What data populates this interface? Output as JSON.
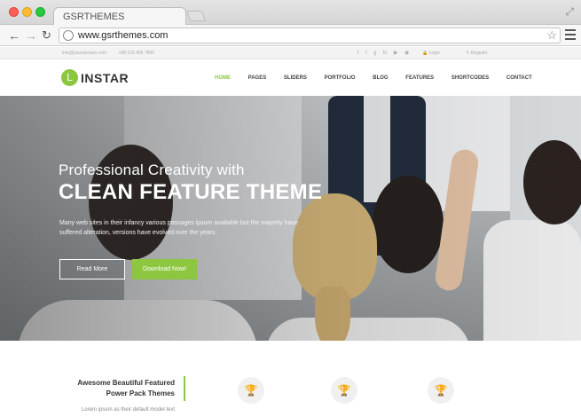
{
  "browser": {
    "tab_title": "GSRTHEMES",
    "url": "www.gsrthemes.com"
  },
  "infobar": {
    "email": "info@yourdomain.com",
    "phone": "+88 123 456 7890",
    "social_icons": [
      "twitter-icon",
      "facebook-icon",
      "google-plus-icon",
      "linkedin-icon",
      "youtube-icon",
      "rss-icon"
    ],
    "login": "Login",
    "register": "Register"
  },
  "header": {
    "logo_letter": "L",
    "logo_text": "INSTAR",
    "nav": [
      "HOME",
      "PAGES",
      "SLIDERS",
      "PORTFOLIO",
      "BLOG",
      "FEATURES",
      "SHORTCODES",
      "CONTACT"
    ],
    "active_nav": "HOME"
  },
  "hero": {
    "subtitle": "Professional Creativity with",
    "title": "CLEAN FEATURE THEME",
    "description": "Many web sites in their infancy various passages ipsum available but the majority have suffered alteration, versions have evolved over the years.",
    "btn_read": "Read More",
    "btn_download": "Download Now!"
  },
  "features": {
    "title_line1": "Awesome Beautiful Featured",
    "title_line2": "Power Pack Themes",
    "subtitle": "Lorem ipsum as their default model text",
    "icons": [
      "trophy-icon",
      "trophy-icon",
      "trophy-icon"
    ]
  },
  "colors": {
    "accent": "#8dc63f"
  }
}
